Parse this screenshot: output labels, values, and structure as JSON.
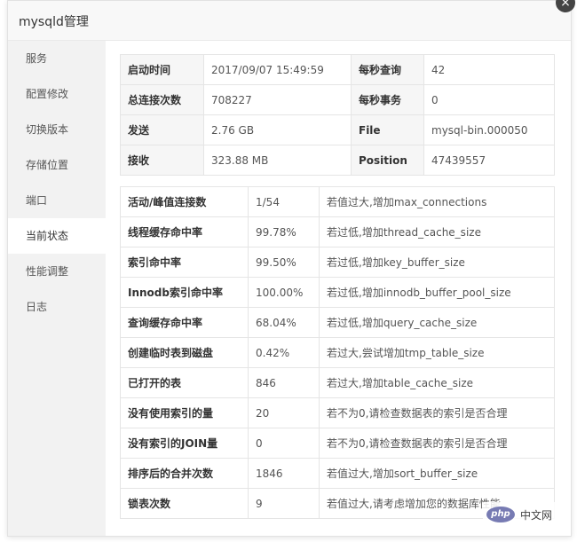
{
  "window": {
    "title": "mysqld管理",
    "close_glyph": "×"
  },
  "sidebar": {
    "items": [
      {
        "label": "服务",
        "active": false
      },
      {
        "label": "配置修改",
        "active": false
      },
      {
        "label": "切换版本",
        "active": false
      },
      {
        "label": "存储位置",
        "active": false
      },
      {
        "label": "端口",
        "active": false
      },
      {
        "label": "当前状态",
        "active": true
      },
      {
        "label": "性能调整",
        "active": false
      },
      {
        "label": "日志",
        "active": false
      }
    ]
  },
  "info_table": {
    "rows": [
      [
        "启动时间",
        "2017/09/07 15:49:59",
        "每秒查询",
        "42"
      ],
      [
        "总连接次数",
        "708227",
        "每秒事务",
        "0"
      ],
      [
        "发送",
        "2.76 GB",
        "File",
        "mysql-bin.000050"
      ],
      [
        "接收",
        "323.88 MB",
        "Position",
        "47439557"
      ]
    ]
  },
  "stats_table": {
    "rows": [
      [
        "活动/峰值连接数",
        "1/54",
        "若值过大,增加max_connections"
      ],
      [
        "线程缓存命中率",
        "99.78%",
        "若过低,增加thread_cache_size"
      ],
      [
        "索引命中率",
        "99.50%",
        "若过低,增加key_buffer_size"
      ],
      [
        "Innodb索引命中率",
        "100.00%",
        "若过低,增加innodb_buffer_pool_size"
      ],
      [
        "查询缓存命中率",
        "68.04%",
        "若过低,增加query_cache_size"
      ],
      [
        "创建临时表到磁盘",
        "0.42%",
        "若过大,尝试增加tmp_table_size"
      ],
      [
        "已打开的表",
        "846",
        "若过大,增加table_cache_size"
      ],
      [
        "没有使用索引的量",
        "20",
        "若不为0,请检查数据表的索引是否合理"
      ],
      [
        "没有索引的JOIN量",
        "0",
        "若不为0,请检查数据表的索引是否合理"
      ],
      [
        "排序后的合并次数",
        "1846",
        "若值过大,增加sort_buffer_size"
      ],
      [
        "锁表次数",
        "9",
        "若值过大,请考虑增加您的数据库性能"
      ]
    ]
  },
  "watermark": {
    "logo_text": "php",
    "site_text": "中文网"
  }
}
